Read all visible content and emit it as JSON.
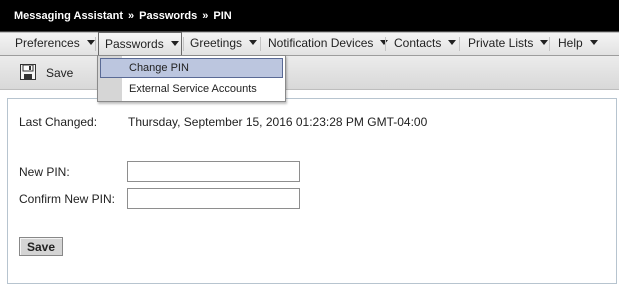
{
  "titlebar": {
    "crumbs": [
      "Messaging Assistant",
      "Passwords",
      "PIN"
    ],
    "separator": "»"
  },
  "menubar": {
    "items": [
      {
        "label": "Preferences"
      },
      {
        "label": "Passwords"
      },
      {
        "label": "Greetings"
      },
      {
        "label": "Notification Devices"
      },
      {
        "label": "Contacts"
      },
      {
        "label": "Private Lists"
      },
      {
        "label": "Help"
      }
    ],
    "active": "Passwords"
  },
  "toolbar": {
    "save_label": "Save",
    "save_icon": "floppy-disk-icon"
  },
  "dropdown": {
    "items": [
      {
        "label": "Change PIN",
        "selected": true
      },
      {
        "label": "External Service Accounts",
        "selected": false
      }
    ]
  },
  "form": {
    "last_changed_label": "Last Changed:",
    "last_changed_value": "Thursday, September 15, 2016 01:23:28 PM GMT-04:00",
    "new_pin_label": "New PIN:",
    "new_pin_value": "",
    "confirm_pin_label": "Confirm New PIN:",
    "confirm_pin_value": "",
    "save_button": "Save"
  },
  "colors": {
    "titlebar_bg": "#000000",
    "menu_selected_bg": "#bcc6df",
    "panel_border": "#b7c4cf"
  }
}
